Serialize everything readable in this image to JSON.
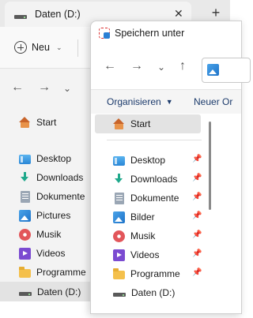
{
  "background_window": {
    "tab_title": "Daten (D:)",
    "tab_close_icon": "close-icon",
    "new_tab_label": "+",
    "new_button_label": "Neu",
    "nav": {
      "back_icon": "back-arrow-icon",
      "forward_icon": "forward-arrow-icon",
      "recent_icon": "chevron-down-icon"
    },
    "sidebar": {
      "start_label": "Start",
      "items": [
        {
          "label": "Desktop",
          "icon": "desktop-icon"
        },
        {
          "label": "Downloads",
          "icon": "downloads-icon"
        },
        {
          "label": "Dokumente",
          "icon": "documents-icon"
        },
        {
          "label": "Pictures",
          "icon": "pictures-icon"
        },
        {
          "label": "Musik",
          "icon": "music-icon"
        },
        {
          "label": "Videos",
          "icon": "videos-icon"
        },
        {
          "label": "Programme",
          "icon": "folder-icon"
        },
        {
          "label": "Daten (D:)",
          "icon": "drive-icon"
        }
      ]
    }
  },
  "dialog": {
    "title": "Speichern unter",
    "nav": {
      "back_icon": "back-arrow-icon",
      "forward_icon": "forward-arrow-icon",
      "recent_icon": "chevron-down-icon",
      "up_icon": "up-arrow-icon"
    },
    "organize_label": "Organisieren",
    "new_folder_label": "Neuer Or",
    "start_label": "Start",
    "items": [
      {
        "label": "Desktop",
        "icon": "desktop-icon",
        "pinned": true
      },
      {
        "label": "Downloads",
        "icon": "downloads-icon",
        "pinned": true
      },
      {
        "label": "Dokumente",
        "icon": "documents-icon",
        "pinned": true
      },
      {
        "label": "Bilder",
        "icon": "pictures-icon",
        "pinned": true
      },
      {
        "label": "Musik",
        "icon": "music-icon",
        "pinned": true
      },
      {
        "label": "Videos",
        "icon": "videos-icon",
        "pinned": true
      },
      {
        "label": "Programme",
        "icon": "folder-icon",
        "pinned": true
      },
      {
        "label": "Daten (D:)",
        "icon": "drive-icon",
        "pinned": false
      }
    ],
    "pin_glyph": "📌"
  }
}
